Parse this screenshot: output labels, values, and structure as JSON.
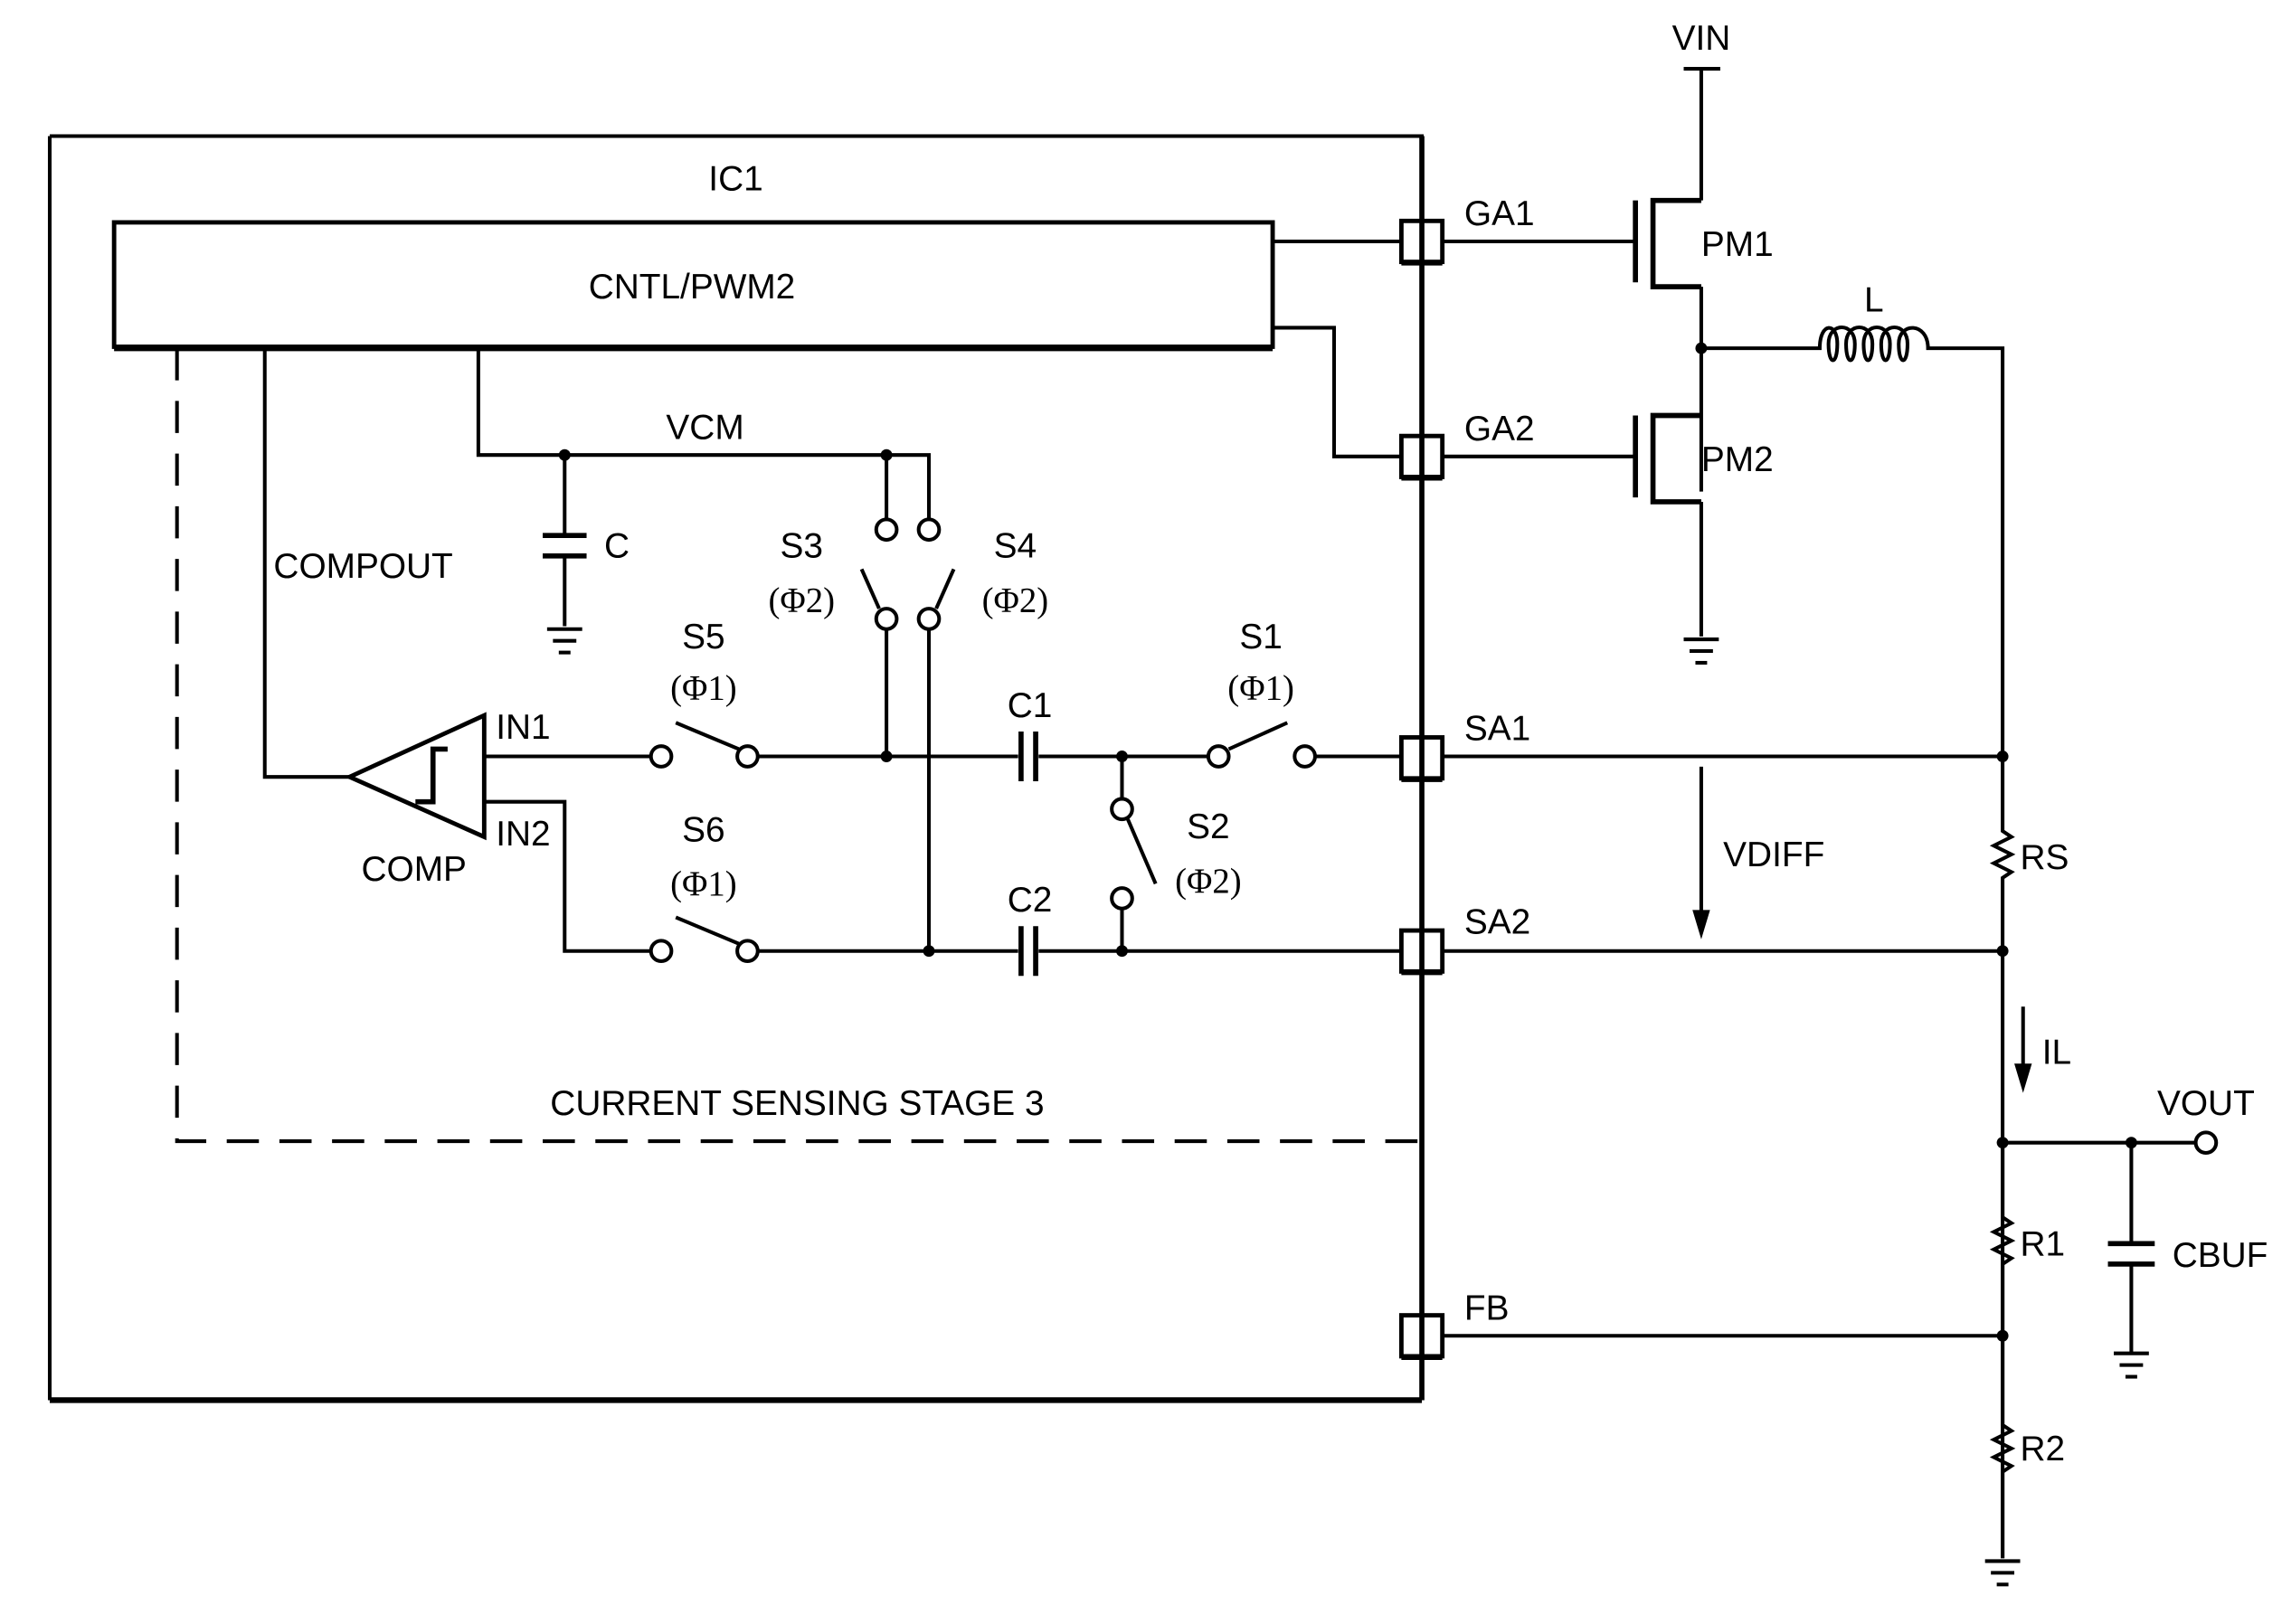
{
  "diagram": {
    "ic_label": "IC1",
    "controller_label": "CNTL/PWM2",
    "stage_label": "CURRENT SENSING STAGE 3",
    "vcm_label": "VCM",
    "compout_label": "COMPOUT",
    "comp_label": "COMP",
    "cap_c_label": "C",
    "in1_label": "IN1",
    "in2_label": "IN2",
    "pins": {
      "ga1": "GA1",
      "ga2": "GA2",
      "sa1": "SA1",
      "sa2": "SA2",
      "fb": "FB"
    },
    "switches": [
      {
        "name": "S1",
        "phase": "(Φ1)"
      },
      {
        "name": "S2",
        "phase": "(Φ2)"
      },
      {
        "name": "S3",
        "phase": "(Φ2)"
      },
      {
        "name": "S4",
        "phase": "(Φ2)"
      },
      {
        "name": "S5",
        "phase": "(Φ1)"
      },
      {
        "name": "S6",
        "phase": "(Φ1)"
      }
    ],
    "capacitors": {
      "c1": "C1",
      "c2": "C2",
      "cbuf": "CBUF"
    },
    "transistors": {
      "pm1": "PM1",
      "pm2": "PM2"
    },
    "inductor": "L",
    "resistors": {
      "rs": "RS",
      "r1": "R1",
      "r2": "R2"
    },
    "nets": {
      "vin": "VIN",
      "vout": "VOUT",
      "vdiff": "VDIFF",
      "il": "IL"
    }
  }
}
